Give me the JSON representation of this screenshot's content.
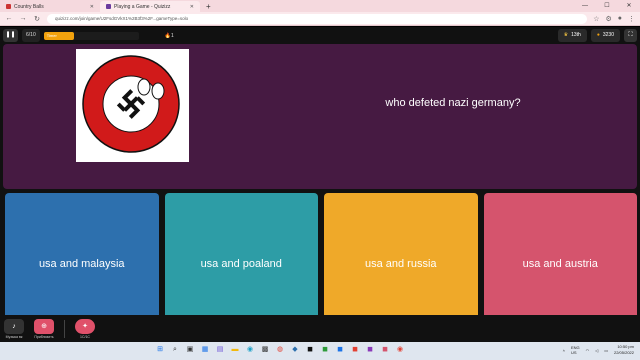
{
  "browser": {
    "tabs": [
      {
        "title": "Country Balls",
        "active": false
      },
      {
        "title": "Playing a Game - Quizizz",
        "active": true
      }
    ],
    "new_tab": "+",
    "url": "quizizz.com/join/game/U2FsdGVkX1%2B3f3%2F...gameType=solo",
    "controls": {
      "minimize": "—",
      "maximize": "☐",
      "close": "✕"
    }
  },
  "game": {
    "question_counter": "6/10",
    "timer_label": "Timer",
    "timer_progress": 0.32,
    "streak": "🔥1",
    "rank": "13th",
    "score": "3230",
    "question": {
      "text": "who defeted nazi germany?",
      "image_icon": "nazi-germany-countryball"
    },
    "answers": [
      {
        "label": "usa and malaysia",
        "color": "#2d70ae"
      },
      {
        "label": "usa and poaland",
        "color": "#2d9da6"
      },
      {
        "label": "usa and russia",
        "color": "#efa929"
      },
      {
        "label": "usa and austria",
        "color": "#d5546d"
      }
    ],
    "bottom": {
      "music_label": "Музыка вк",
      "zoom_label": "Приблизить",
      "powerup_label": "1С/1С"
    }
  },
  "taskbar": {
    "lang_top": "ENG",
    "lang_bottom": "US",
    "time": "10:50 pm",
    "date": "22/05/2022"
  }
}
